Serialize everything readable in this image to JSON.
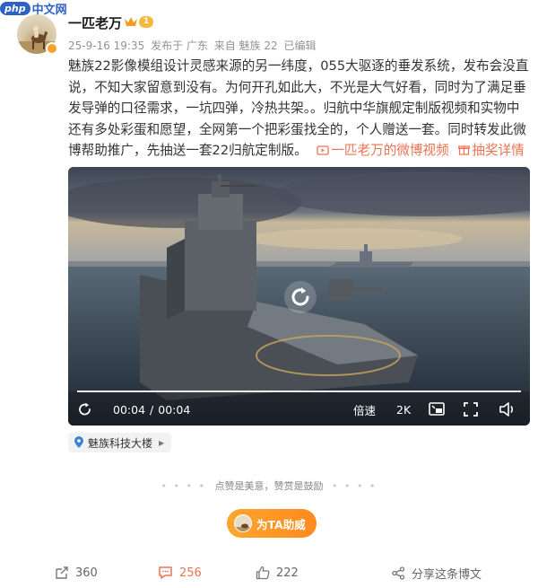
{
  "watermark": {
    "php": "php",
    "cn": "中文网"
  },
  "author": {
    "name": "一匹老万",
    "level": "1"
  },
  "meta": {
    "time": "25-9-16 19:35",
    "published_from": "发布于 广东",
    "source": "来自 魅族 22",
    "edited": "已编辑"
  },
  "post": {
    "text": "魅族22影像模组设计灵感来源的另一纬度，055大驱逐的垂发系统，发布会没直说，不知大家留意到没有。为何开孔如此大，不光是大气好看，同时为了满足垂发导弹的口径需求，一坑四弹，冷热共架。。归航中华旗舰定制版视频和实物中还有多处彩蛋和愿望，全网第一个把彩蛋找全的，个人赠送一套。同时转发此微博帮助推广，先抽送一套22归航定制版。",
    "video_link": "一匹老万的微博视频",
    "lottery_link": "抽奖详情"
  },
  "video": {
    "current_time": "00:04",
    "separator": "/",
    "duration": "00:04",
    "speed_label": "倍速",
    "quality_label": "2K",
    "progress": 1.0
  },
  "location": {
    "label": "魅族科技大楼"
  },
  "divider": {
    "text": "点赞是美意，赞赏是鼓励"
  },
  "support": {
    "label": "为TA助威"
  },
  "actions": {
    "repost_count": "360",
    "comment_count": "256",
    "like_count": "222",
    "share_label": "分享这条博文"
  },
  "colors": {
    "accent": "#eb7350",
    "support_button": "#ff9a24",
    "level_badge": "#f9b73b",
    "location_pin": "#3b82d6"
  },
  "icons": [
    "crown-icon",
    "replay-icon",
    "picture-in-picture-icon",
    "fullscreen-icon",
    "volume-icon",
    "location-pin-icon",
    "repost-icon",
    "comment-icon",
    "like-icon",
    "share-icon"
  ]
}
